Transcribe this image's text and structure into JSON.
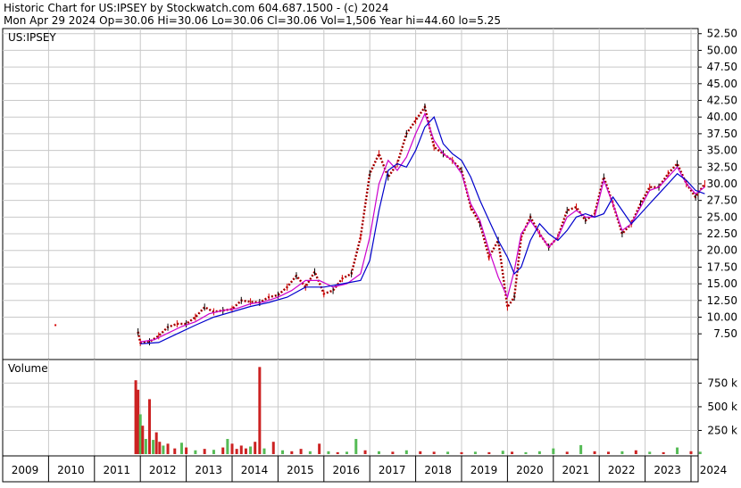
{
  "header": {
    "line1": "Historic Chart for US:IPSEY by Stockwatch.com 604.687.1500 - (c) 2024",
    "line2": "Mon Apr 29 2024  Op=30.06  Hi=30.06  Lo=30.06  Cl=30.06  Vol=1,506  Year hi=44.60  lo=5.25"
  },
  "colors": {
    "price_up": "#000000",
    "price_down": "#d40000",
    "ma_short": "#cc00cc",
    "ma_long": "#0000cc",
    "volume_up": "#55bb55",
    "volume_down": "#cc2222",
    "grid": "#c8c8c8"
  },
  "chart_data": [
    {
      "type": "line",
      "title": "US:IPSEY",
      "ylim": [
        5.25,
        53
      ],
      "yticks": [
        "52.50",
        "50.00",
        "47.50",
        "45.00",
        "42.50",
        "40.00",
        "37.50",
        "35.00",
        "32.50",
        "30.00",
        "27.50",
        "25.00",
        "22.50",
        "20.00",
        "17.50",
        "15.00",
        "12.50",
        "10.00",
        "7.50"
      ],
      "ytick_values": [
        52.5,
        50,
        47.5,
        45,
        42.5,
        40,
        37.5,
        35,
        32.5,
        30,
        27.5,
        25,
        22.5,
        20,
        17.5,
        15,
        12.5,
        10,
        7.5
      ],
      "x_labels": [
        "2009",
        "2010",
        "2011",
        "2012",
        "2013",
        "2014",
        "2015",
        "2016",
        "2017",
        "2018",
        "2019",
        "2020",
        "2021",
        "2022",
        "2023",
        "2024"
      ],
      "x_label_years": [
        2009,
        2010,
        2011,
        2012,
        2013,
        2014,
        2015,
        2016,
        2017,
        2018,
        2019,
        2020,
        2021,
        2022,
        2023,
        2024
      ],
      "grid": true,
      "series": [
        {
          "style": "price",
          "x": [
            2010.15,
            2011.95,
            2012.0,
            2012.2,
            2012.4,
            2012.6,
            2012.8,
            2013.0,
            2013.2,
            2013.4,
            2013.6,
            2013.8,
            2014.0,
            2014.2,
            2014.4,
            2014.6,
            2014.8,
            2015.0,
            2015.2,
            2015.4,
            2015.6,
            2015.8,
            2016.0,
            2016.2,
            2016.4,
            2016.6,
            2016.8,
            2017.0,
            2017.2,
            2017.4,
            2017.6,
            2017.8,
            2018.0,
            2018.2,
            2018.4,
            2018.6,
            2018.8,
            2019.0,
            2019.2,
            2019.4,
            2019.6,
            2019.8,
            2020.0,
            2020.15,
            2020.3,
            2020.5,
            2020.7,
            2020.9,
            2021.1,
            2021.3,
            2021.5,
            2021.7,
            2021.9,
            2022.1,
            2022.3,
            2022.5,
            2022.7,
            2022.9,
            2023.1,
            2023.3,
            2023.5,
            2023.7,
            2023.9,
            2024.1,
            2024.3
          ],
          "y": [
            8.8,
            7.8,
            6.2,
            6.3,
            7.2,
            8.5,
            9.0,
            9.0,
            10.0,
            11.5,
            10.8,
            11.0,
            11.2,
            12.5,
            12.3,
            12.2,
            13.0,
            13.3,
            14.5,
            16.2,
            14.5,
            16.8,
            13.5,
            14.0,
            15.8,
            16.5,
            22.0,
            31.5,
            34.5,
            31.0,
            33.0,
            37.5,
            39.5,
            41.5,
            35.5,
            34.5,
            33.5,
            32.0,
            26.5,
            24.0,
            19.0,
            21.5,
            11.5,
            13.0,
            22.0,
            25.0,
            22.5,
            20.5,
            22.0,
            26.0,
            26.5,
            24.5,
            25.5,
            31.0,
            27.0,
            22.5,
            24.0,
            27.0,
            29.5,
            29.5,
            31.5,
            33.0,
            30.0,
            28.0,
            30.0
          ]
        },
        {
          "style": "ma_short",
          "x": [
            2012.0,
            2012.3,
            2012.6,
            2012.9,
            2013.2,
            2013.5,
            2013.8,
            2014.1,
            2014.4,
            2014.7,
            2015.0,
            2015.3,
            2015.6,
            2015.9,
            2016.2,
            2016.5,
            2016.8,
            2017.0,
            2017.2,
            2017.4,
            2017.6,
            2017.8,
            2018.0,
            2018.2,
            2018.4,
            2018.6,
            2018.8,
            2019.0,
            2019.2,
            2019.4,
            2019.6,
            2019.8,
            2020.0,
            2020.15,
            2020.3,
            2020.5,
            2020.7,
            2020.9,
            2021.1,
            2021.3,
            2021.5,
            2021.7,
            2021.9,
            2022.1,
            2022.3,
            2022.5,
            2022.7,
            2022.9,
            2023.1,
            2023.3,
            2023.5,
            2023.7,
            2023.9,
            2024.1,
            2024.3
          ],
          "y": [
            6.3,
            6.6,
            7.6,
            8.6,
            9.3,
            10.5,
            11.0,
            11.3,
            12.0,
            12.3,
            13.0,
            14.0,
            15.5,
            15.5,
            14.5,
            15.0,
            16.5,
            22.0,
            30.0,
            33.5,
            32.0,
            34.0,
            37.5,
            40.5,
            36.5,
            34.5,
            33.5,
            31.5,
            27.0,
            24.5,
            20.0,
            16.0,
            13.0,
            17.0,
            22.5,
            24.5,
            22.5,
            20.5,
            22.0,
            25.0,
            26.0,
            25.0,
            25.0,
            30.5,
            27.0,
            23.0,
            24.0,
            26.5,
            29.0,
            29.5,
            31.0,
            32.5,
            30.0,
            28.5,
            29.5
          ]
        },
        {
          "style": "ma_long",
          "x": [
            2012.0,
            2012.4,
            2012.8,
            2013.2,
            2013.6,
            2014.0,
            2014.4,
            2014.8,
            2015.2,
            2015.6,
            2016.0,
            2016.4,
            2016.8,
            2017.0,
            2017.2,
            2017.4,
            2017.6,
            2017.8,
            2018.0,
            2018.2,
            2018.4,
            2018.6,
            2018.8,
            2019.0,
            2019.2,
            2019.4,
            2019.6,
            2019.8,
            2020.0,
            2020.15,
            2020.3,
            2020.5,
            2020.7,
            2020.9,
            2021.1,
            2021.3,
            2021.5,
            2021.7,
            2021.9,
            2022.1,
            2022.3,
            2022.5,
            2022.7,
            2022.9,
            2023.1,
            2023.3,
            2023.5,
            2023.7,
            2023.9,
            2024.1,
            2024.3
          ],
          "y": [
            6.0,
            6.2,
            7.5,
            8.8,
            10.0,
            10.8,
            11.6,
            12.2,
            13.0,
            14.5,
            14.5,
            15.0,
            15.5,
            18.5,
            26.0,
            32.0,
            33.0,
            32.5,
            35.0,
            38.5,
            40.0,
            36.0,
            34.5,
            33.5,
            31.0,
            27.5,
            24.5,
            21.5,
            19.0,
            16.5,
            17.5,
            21.5,
            24.0,
            22.5,
            21.5,
            23.0,
            25.0,
            25.5,
            25.0,
            25.5,
            28.0,
            26.0,
            24.0,
            25.5,
            27.0,
            28.5,
            30.0,
            31.5,
            30.5,
            29.0,
            28.5
          ]
        }
      ]
    },
    {
      "type": "bar",
      "title": "Volume",
      "ylim": [
        0,
        980
      ],
      "yticks": [
        "750 k",
        "500 k",
        "250 k"
      ],
      "ytick_values": [
        750,
        500,
        250
      ],
      "x_labels": [
        "2009",
        "2010",
        "2011",
        "2012",
        "2013",
        "2014",
        "2015",
        "2016",
        "2017",
        "2018",
        "2019",
        "2020",
        "2021",
        "2022",
        "2023",
        "2024"
      ],
      "series": [
        {
          "name": "",
          "x": [
            2011.9,
            2011.95,
            2012.0,
            2012.05,
            2012.12,
            2012.2,
            2012.28,
            2012.35,
            2012.42,
            2012.5,
            2012.6,
            2012.75,
            2012.9,
            2013.0,
            2013.2,
            2013.4,
            2013.6,
            2013.8,
            2013.9,
            2014.0,
            2014.1,
            2014.2,
            2014.3,
            2014.4,
            2014.5,
            2014.6,
            2014.7,
            2014.9,
            2015.1,
            2015.3,
            2015.5,
            2015.7,
            2015.9,
            2016.1,
            2016.3,
            2016.5,
            2016.7,
            2016.9,
            2017.2,
            2017.5,
            2017.8,
            2018.1,
            2018.4,
            2018.7,
            2019.0,
            2019.3,
            2019.6,
            2019.9,
            2020.1,
            2020.4,
            2020.7,
            2021.0,
            2021.3,
            2021.6,
            2021.9,
            2022.2,
            2022.5,
            2022.8,
            2023.1,
            2023.4,
            2023.7,
            2024.0,
            2024.2
          ],
          "values": [
            780,
            680,
            420,
            300,
            160,
            580,
            150,
            230,
            130,
            90,
            110,
            60,
            120,
            70,
            40,
            55,
            45,
            70,
            160,
            110,
            55,
            90,
            60,
            80,
            130,
            920,
            60,
            130,
            40,
            30,
            55,
            30,
            110,
            30,
            20,
            25,
            160,
            40,
            30,
            25,
            40,
            30,
            25,
            25,
            20,
            25,
            20,
            35,
            25,
            20,
            30,
            60,
            25,
            95,
            30,
            25,
            30,
            40,
            25,
            20,
            70,
            30,
            25
          ],
          "colors": [
            "down",
            "down",
            "up",
            "down",
            "up",
            "down",
            "up",
            "down",
            "down",
            "up",
            "down",
            "down",
            "up",
            "down",
            "up",
            "down",
            "up",
            "down",
            "up",
            "down",
            "down",
            "down",
            "down",
            "up",
            "down",
            "down",
            "up",
            "down",
            "up",
            "down",
            "down",
            "up",
            "down",
            "up",
            "down",
            "up",
            "up",
            "down",
            "up",
            "down",
            "up",
            "down",
            "down",
            "up",
            "down",
            "up",
            "down",
            "up",
            "down",
            "up",
            "up",
            "up",
            "down",
            "up",
            "down",
            "down",
            "up",
            "down",
            "up",
            "down",
            "up",
            "down",
            "up"
          ]
        }
      ]
    }
  ]
}
